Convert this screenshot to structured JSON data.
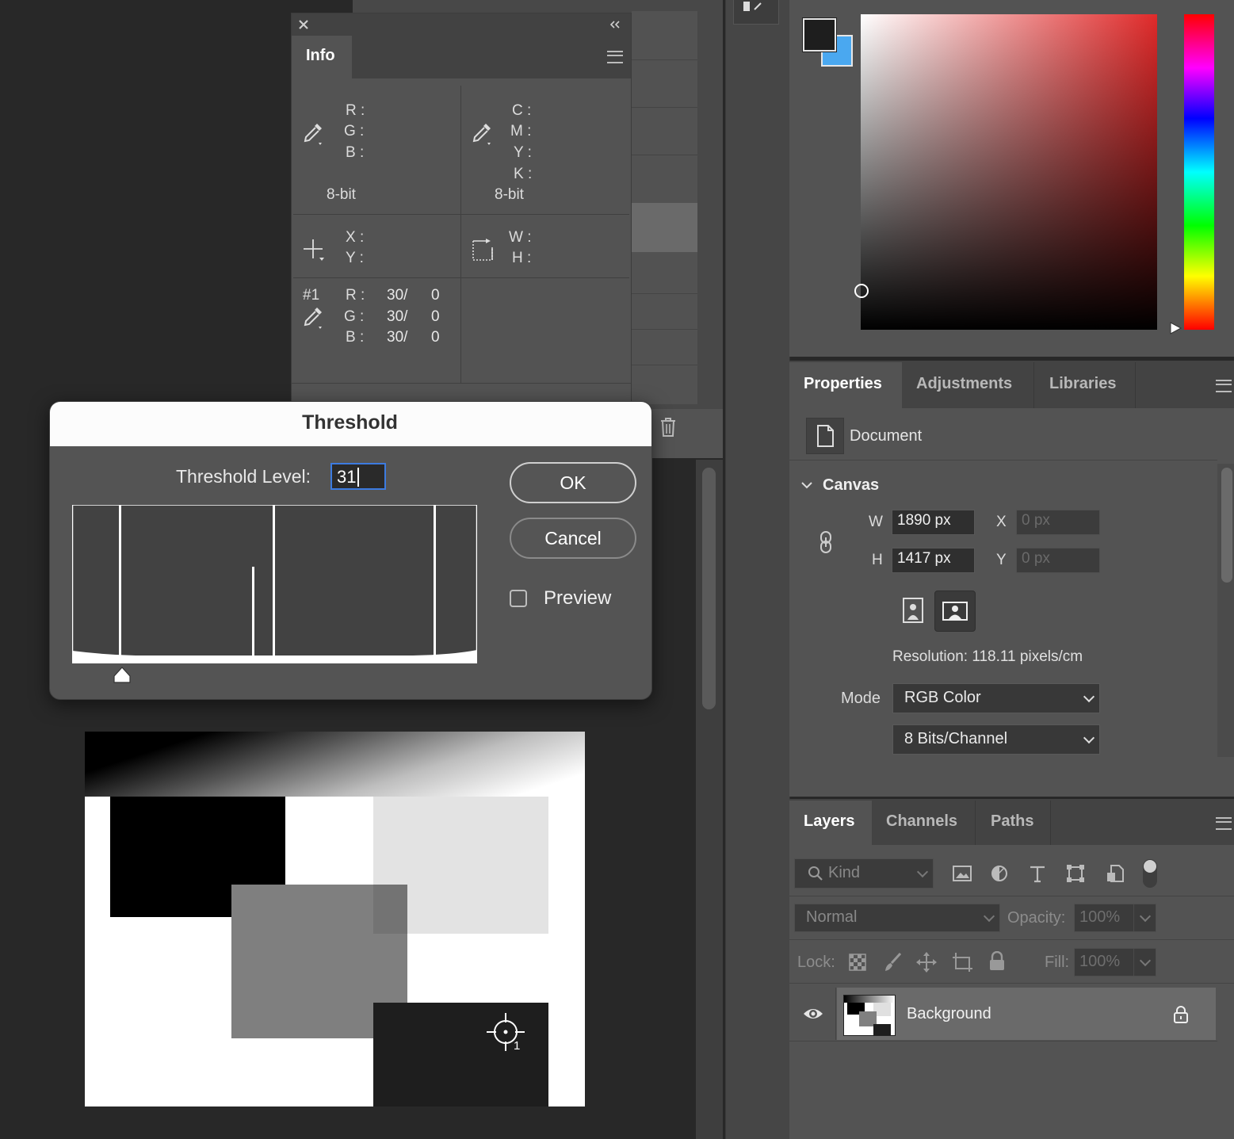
{
  "info_panel": {
    "tab": "Info",
    "rgb_labels": [
      "R :",
      "G :",
      "B :"
    ],
    "cmyk_labels": [
      "C :",
      "M :",
      "Y :",
      "K :"
    ],
    "bit_left": "8-bit",
    "bit_right": "8-bit",
    "xy_labels": [
      "X :",
      "Y :"
    ],
    "wh_labels": [
      "W :",
      "H :"
    ],
    "sampler": {
      "id": "#1",
      "labels": [
        "R :",
        "G :",
        "B :"
      ],
      "values": [
        "30/",
        "30/",
        "30/"
      ],
      "after": [
        "0",
        "0",
        "0"
      ]
    }
  },
  "threshold_dialog": {
    "title": "Threshold",
    "level_label": "Threshold Level:",
    "level_value": "31",
    "ok_label": "OK",
    "cancel_label": "Cancel",
    "preview_label": "Preview",
    "preview_checked": false
  },
  "properties_panel": {
    "tabs": [
      "Properties",
      "Adjustments",
      "Libraries"
    ],
    "document_label": "Document",
    "canvas_label": "Canvas",
    "w_label": "W",
    "w_value": "1890 px",
    "h_label": "H",
    "h_value": "1417 px",
    "x_label": "X",
    "x_placeholder": "0 px",
    "y_label": "Y",
    "y_placeholder": "0 px",
    "resolution": "Resolution: 118.11 pixels/cm",
    "mode_label": "Mode",
    "mode_value": "RGB Color",
    "depth_value": "8 Bits/Channel"
  },
  "layers_panel": {
    "tabs": [
      "Layers",
      "Channels",
      "Paths"
    ],
    "filter_kind": "Kind",
    "blend_mode": "Normal",
    "opacity_label": "Opacity:",
    "opacity_value": "100%",
    "lock_label": "Lock:",
    "fill_label": "Fill:",
    "fill_value": "100%",
    "layer_name": "Background"
  },
  "canvas": {
    "sampler_number": "1"
  },
  "colors": {
    "foreground": "#1e1e1e",
    "background": "#4aa8f0",
    "picker_hue": "#e02a2a",
    "panel_bg": "#535353",
    "dialog_bg": "#545454"
  }
}
